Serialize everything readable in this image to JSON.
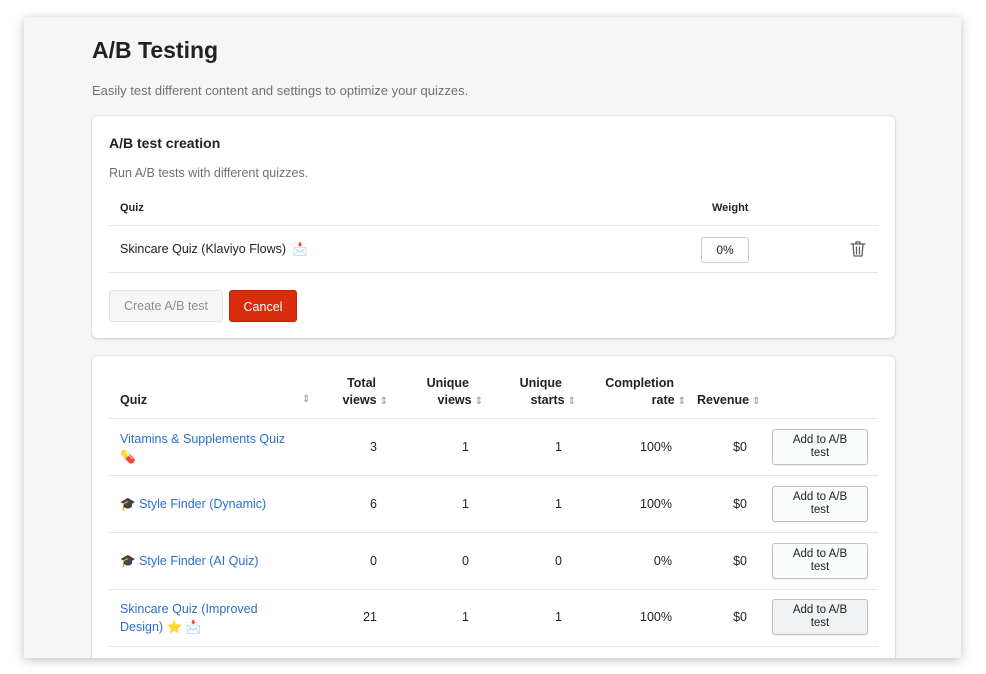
{
  "page": {
    "title": "A/B Testing",
    "subtitle": "Easily test different content and settings to optimize your quizzes."
  },
  "creation_card": {
    "title": "A/B test creation",
    "description": "Run A/B tests with different quizzes.",
    "col_quiz": "Quiz",
    "col_weight": "Weight",
    "row": {
      "name": "Skincare Quiz (Klaviyo Flows)",
      "emoji": "📩",
      "weight": "0%"
    },
    "create_button": "Create A/B test",
    "cancel_button": "Cancel"
  },
  "quiz_table": {
    "headers": {
      "quiz": "Quiz",
      "total_1": "Total",
      "total_2": "views",
      "unique_views_1": "Unique",
      "unique_views_2": "views",
      "unique_starts_1": "Unique",
      "unique_starts_2": "starts",
      "completion_1": "Completion",
      "completion_2": "rate",
      "revenue": "Revenue",
      "sort_icon": "⇕"
    },
    "add_button_line1": "Add to A/B",
    "add_button_line2": "test",
    "rows": [
      {
        "name_line1": "Vitamins & Supplements Quiz",
        "name_line2": "💊",
        "prefix": "",
        "total_views": "3",
        "unique_views": "1",
        "unique_starts": "1",
        "completion": "100%",
        "revenue": "$0"
      },
      {
        "name_line1": "Style Finder (Dynamic)",
        "name_line2": "",
        "prefix": "🎓",
        "total_views": "6",
        "unique_views": "1",
        "unique_starts": "1",
        "completion": "100%",
        "revenue": "$0"
      },
      {
        "name_line1": "Style Finder (AI Quiz)",
        "name_line2": "",
        "prefix": "🎓",
        "total_views": "0",
        "unique_views": "0",
        "unique_starts": "0",
        "completion": "0%",
        "revenue": "$0"
      },
      {
        "name_line1": "Skincare Quiz (Improved",
        "name_line2": "Design) ⭐ 📩",
        "prefix": "",
        "total_views": "21",
        "unique_views": "1",
        "unique_starts": "1",
        "completion": "100%",
        "revenue": "$0"
      }
    ]
  },
  "colors": {
    "link": "#2c6ecb",
    "danger": "#d82c0d",
    "background": "#f6f6f7"
  }
}
